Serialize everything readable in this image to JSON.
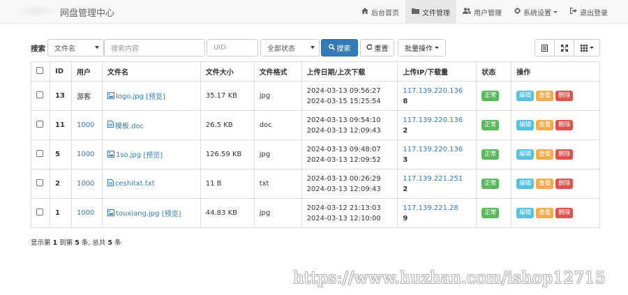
{
  "nav": {
    "brand": "网盘管理中心",
    "items": [
      {
        "icon": "home-icon",
        "label": "后台首页",
        "active": false
      },
      {
        "icon": "folder-icon",
        "label": "文件管理",
        "active": true
      },
      {
        "icon": "users-icon",
        "label": "用户管理",
        "active": false
      },
      {
        "icon": "gear-icon",
        "label": "系统设置",
        "active": false,
        "dropdown": true
      },
      {
        "icon": "logout-icon",
        "label": "退出登录",
        "active": false
      }
    ]
  },
  "toolbar": {
    "search_label": "搜索",
    "field_select": "文件名",
    "search_placeholder": "搜索内容",
    "uid_placeholder": "UID",
    "status_select": "全部状态",
    "search_button": "搜索",
    "reset_button": "重置",
    "batch_button": "批量操作"
  },
  "table": {
    "headers": {
      "id": "ID",
      "user": "用户",
      "filename": "文件名",
      "size": "文件大小",
      "format": "文件格式",
      "dates": "上传日期/上次下载",
      "ip": "上传IP/下载量",
      "status": "状态",
      "actions": "操作"
    },
    "rows": [
      {
        "id": "13",
        "user": "游客",
        "user_link": false,
        "filename": "logo.jpg",
        "preview": "[预览]",
        "size": "35.17 KB",
        "format": "jpg",
        "upload": "2024-03-13 09:56:27",
        "last_download": "2024-03-15 15:25:54",
        "ip": "117.139.220.136",
        "downloads": "8",
        "status": "正常"
      },
      {
        "id": "11",
        "user": "1000",
        "user_link": true,
        "filename": "模板.doc",
        "preview": "",
        "size": "26.5 KB",
        "format": "doc",
        "upload": "2024-03-13 09:54:10",
        "last_download": "2024-03-13 12:09:43",
        "ip": "117.139.220.136",
        "downloads": "2",
        "status": "正常"
      },
      {
        "id": "5",
        "user": "1000",
        "user_link": true,
        "filename": "1so.jpg",
        "preview": "[预览]",
        "size": "126.59 KB",
        "format": "jpg",
        "upload": "2024-03-13 09:48:07",
        "last_download": "2024-03-13 12:09:52",
        "ip": "117.139.220.136",
        "downloads": "3",
        "status": "正常"
      },
      {
        "id": "2",
        "user": "1000",
        "user_link": true,
        "filename": "ceshitxt.txt",
        "preview": "",
        "size": "11 B",
        "format": "txt",
        "upload": "2024-03-13 00:26:29",
        "last_download": "2024-03-13 12:09:43",
        "ip": "117.139.221.251",
        "downloads": "2",
        "status": "正常"
      },
      {
        "id": "1",
        "user": "1000",
        "user_link": true,
        "filename": "touxiang.jpg",
        "preview": "[预览]",
        "size": "44.83 KB",
        "format": "jpg",
        "upload": "2024-03-12 21:13:03",
        "last_download": "2024-03-13 12:10:00",
        "ip": "117.139.221.28",
        "downloads": "9",
        "status": "正常"
      }
    ],
    "action_labels": {
      "edit": "编辑",
      "view": "查看",
      "delete": "删除"
    }
  },
  "summary": {
    "prefix": "显示第 ",
    "from": "1",
    "mid1": " 到第 ",
    "to": "5",
    "mid2": " 条, 总共 ",
    "total": "5",
    "suffix": " 条"
  },
  "watermark": "https://www.huzhan.com/ishop12715",
  "colors": {
    "primary": "#337ab7",
    "success": "#5cb85c",
    "info": "#5bc0de",
    "warning": "#f0ad4e",
    "danger": "#d9534f"
  }
}
